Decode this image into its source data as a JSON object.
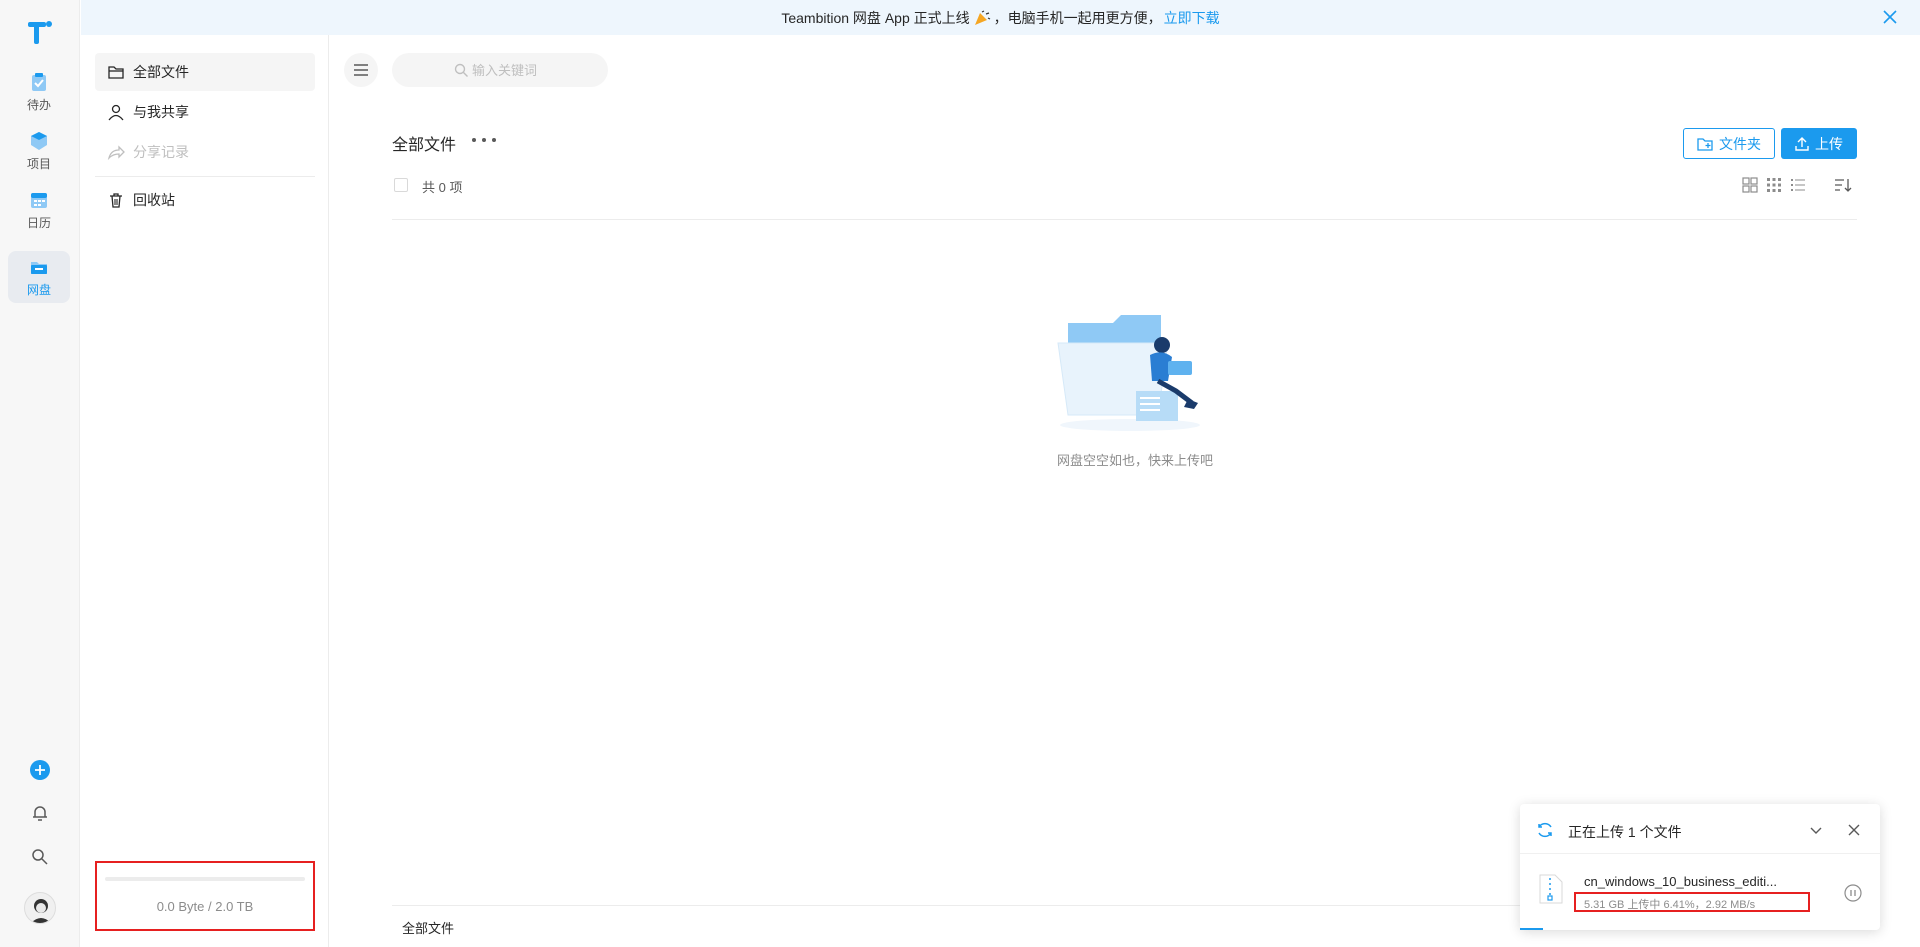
{
  "banner": {
    "text": "Teambition 网盘 App 正式上线",
    "text2": "，电脑手机一起用更方便，",
    "link": "立即下载"
  },
  "rail": {
    "items": [
      {
        "label": "待办",
        "icon": "clipboard-check-icon"
      },
      {
        "label": "项目",
        "icon": "cube-icon"
      },
      {
        "label": "日历",
        "icon": "calendar-icon"
      },
      {
        "label": "网盘",
        "icon": "cloud-drive-icon"
      }
    ],
    "active_index": 3
  },
  "sidenav": {
    "items": [
      {
        "label": "全部文件",
        "icon": "folder-icon"
      },
      {
        "label": "与我共享",
        "icon": "user-icon"
      },
      {
        "label": "分享记录",
        "icon": "share-icon"
      },
      {
        "label": "回收站",
        "icon": "trash-icon"
      }
    ],
    "storage": {
      "text": "0.0 Byte / 2.0 TB",
      "used_fraction": 0.0
    }
  },
  "main": {
    "search_placeholder": "输入关键词",
    "breadcrumb": "全部文件",
    "folder_button": "文件夹",
    "upload_button": "上传",
    "count_text": "共 0 项",
    "empty_text": "网盘空空如也，快来上传吧",
    "footer_breadcrumb": "全部文件"
  },
  "upload_panel": {
    "title": "正在上传 1 个文件",
    "file_name": "cn_windows_10_business_editi...",
    "status": "5.31 GB 上传中 6.41%，2.92 MB/s",
    "progress_fraction": 0.0641
  },
  "colors": {
    "accent": "#1b9aee",
    "highlight_border": "#e62020"
  }
}
